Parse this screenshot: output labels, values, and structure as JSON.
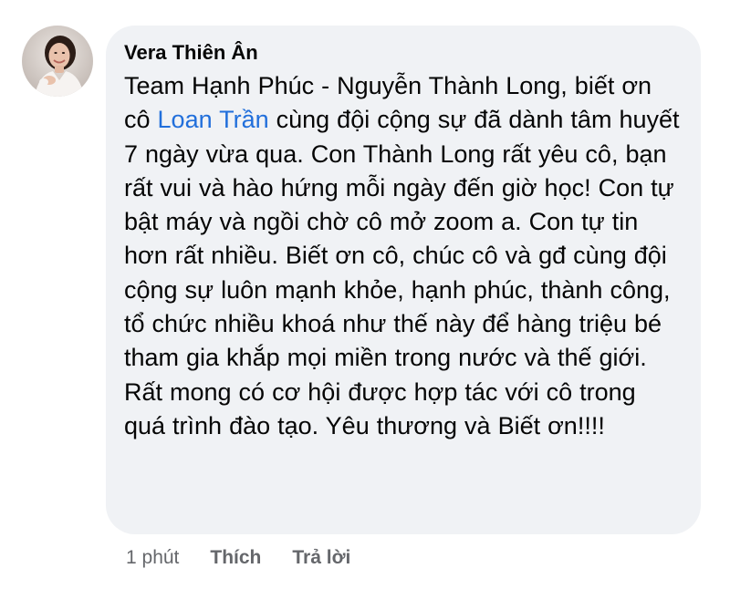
{
  "comment": {
    "author": "Vera Thiên Ân",
    "text_before_mention": "Team Hạnh Phúc - Nguyễn Thành Long, biết ơn cô ",
    "mention": "Loan Trần",
    "text_after_mention": " cùng đội cộng sự đã dành tâm huyết 7 ngày vừa qua. Con Thành Long rất yêu cô, bạn rất vui và hào hứng mỗi ngày đến giờ học! Con tự bật máy và ngồi chờ cô mở zoom a. Con tự tin hơn rất nhiều. Biết ơn cô, chúc cô và gđ cùng đội cộng sự luôn mạnh khỏe, hạnh phúc, thành công, tổ chức nhiều khoá như thế này để hàng triệu bé tham gia khắp mọi miền trong nước và thế giới. Rất mong có cơ hội được hợp tác với cô trong quá trình đào tạo. Yêu thương và Biết ơn!!!!",
    "timestamp": "1 phút",
    "like_label": "Thích",
    "reply_label": "Trả lời"
  },
  "colors": {
    "bubble_bg": "#f0f2f5",
    "text": "#050505",
    "mention": "#216fdb",
    "meta": "#65676b"
  },
  "icons": {
    "avatar": "profile-photo"
  }
}
